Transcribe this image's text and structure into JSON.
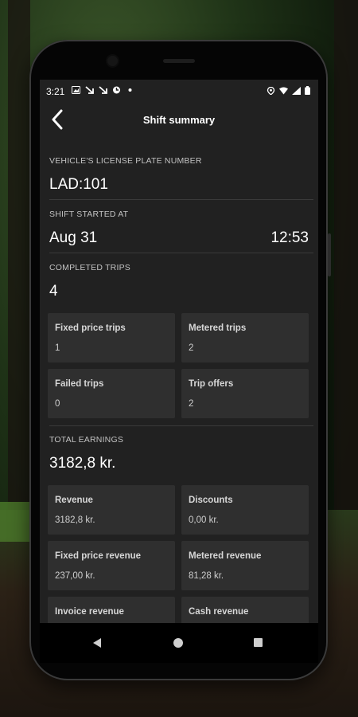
{
  "status_bar": {
    "time": "3:21"
  },
  "toolbar": {
    "title": "Shift summary"
  },
  "vehicle": {
    "label": "VEHICLE'S LICENSE PLATE NUMBER",
    "value": "LAD:101"
  },
  "shift": {
    "label": "SHIFT STARTED AT",
    "date": "Aug 31",
    "time": "12:53"
  },
  "trips": {
    "label": "COMPLETED TRIPS",
    "value": "4",
    "cards": [
      {
        "title": "Fixed price trips",
        "value": "1"
      },
      {
        "title": "Metered trips",
        "value": "2"
      },
      {
        "title": "Failed trips",
        "value": "0"
      },
      {
        "title": "Trip offers",
        "value": "2"
      }
    ]
  },
  "earnings": {
    "label": "TOTAL EARNINGS",
    "value": "3182,8 kr.",
    "cards": [
      {
        "title": "Revenue",
        "value": "3182,8 kr."
      },
      {
        "title": "Discounts",
        "value": "0,00 kr."
      },
      {
        "title": "Fixed price revenue",
        "value": "237,00 kr."
      },
      {
        "title": "Metered revenue",
        "value": "81,28 kr."
      },
      {
        "title": "Invoice revenue",
        "value": ""
      },
      {
        "title": "Cash revenue",
        "value": ""
      }
    ]
  }
}
